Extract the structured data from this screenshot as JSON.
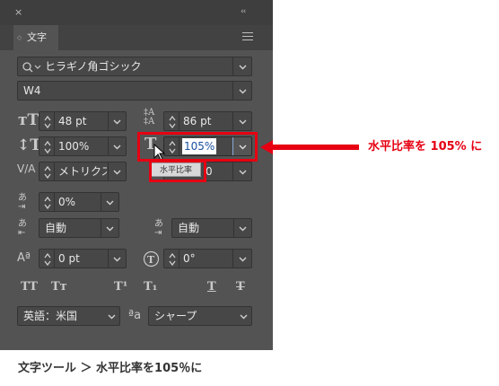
{
  "panel": {
    "close_glyph": "×",
    "collapse_glyph": "‹‹",
    "tab_label": "文字",
    "font_family": "ヒラギノ角ゴシック",
    "font_style": "W4",
    "font_size": "48 pt",
    "leading": "86 pt",
    "vertical_scale": "100%",
    "horizontal_scale": "105%",
    "kerning": "メトリクス",
    "tracking_partial": "0",
    "tsume": "0%",
    "aki_before": "自動",
    "aki_after": "自動",
    "baseline_shift": "0 pt",
    "rotation": "0°",
    "language": "英語：米国",
    "antialias_icon_text": "ªa",
    "antialias": "シャープ",
    "tooltip": "水平比率",
    "style_buttons": [
      "TT",
      "Tт",
      "T¹",
      "T₁",
      "T",
      "T"
    ]
  },
  "annotation": {
    "label": "水平比率を 105% に",
    "color": "#e60012"
  },
  "caption": "文字ツール ＞ 水平比率を105％に"
}
